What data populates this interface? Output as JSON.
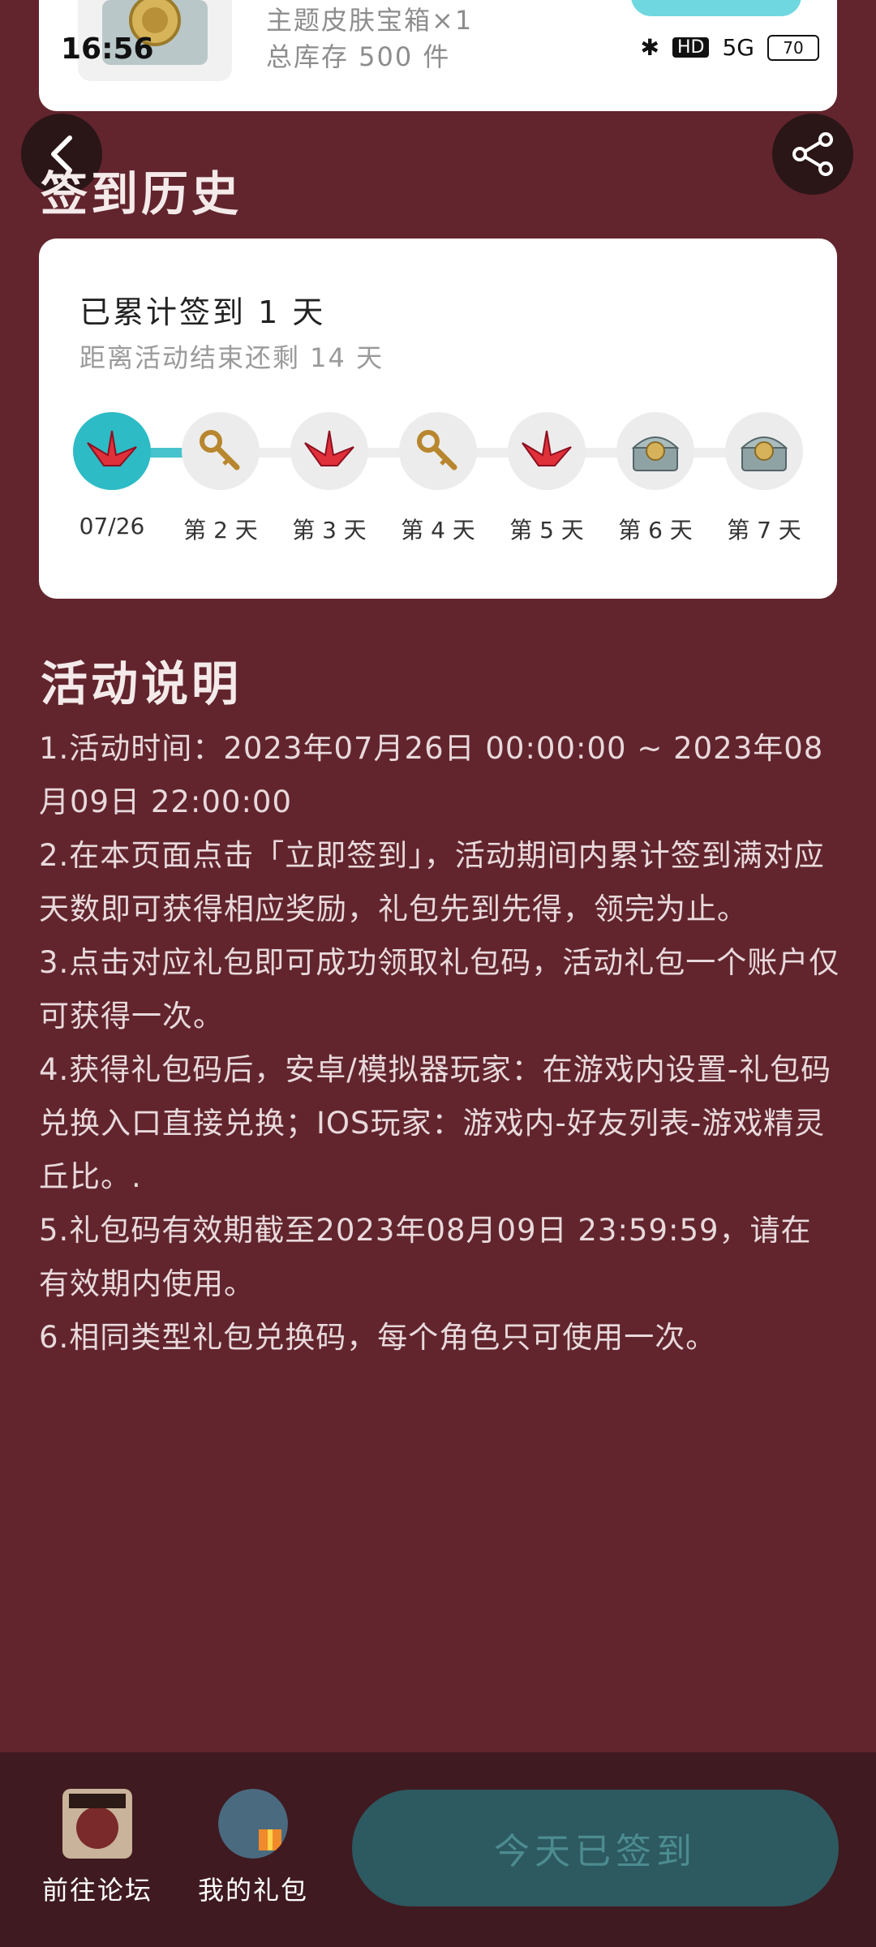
{
  "status": {
    "time": "16:56",
    "battery": "70",
    "hd": "HD",
    "net": "5G"
  },
  "top_card": {
    "line1": "主题皮肤宝箱×1",
    "line2": "总库存 500 件"
  },
  "history": {
    "title": "签到历史",
    "total": "已累计签到 1 天",
    "remain": "距离活动结束还剩 14 天",
    "days": [
      {
        "label": "07/26",
        "icon": "paper-crane-icon"
      },
      {
        "label": "第 2 天",
        "icon": "key-icon"
      },
      {
        "label": "第 3 天",
        "icon": "paper-crane-icon"
      },
      {
        "label": "第 4 天",
        "icon": "key-icon"
      },
      {
        "label": "第 5 天",
        "icon": "paper-crane-icon"
      },
      {
        "label": "第 6 天",
        "icon": "treasure-chest-icon"
      },
      {
        "label": "第 7 天",
        "icon": "treasure-chest-icon"
      }
    ]
  },
  "rules": {
    "title": "活动说明",
    "items": [
      "1.活动时间：2023年07月26日 00:00:00 ~ 2023年08月09日 22:00:00",
      "2.在本页面点击「立即签到」，活动期间内累计签到满对应天数即可获得相应奖励，礼包先到先得，领完为止。",
      "3.点击对应礼包即可成功领取礼包码，活动礼包一个账户仅可获得一次。",
      "4.获得礼包码后，安卓/模拟器玩家：在游戏内设置-礼包码兑换入口直接兑换；IOS玩家：游戏内-好友列表-游戏精灵丘比。.",
      "5.礼包码有效期截至2023年08月09日 23:59:59，请在有效期内使用。",
      "6.相同类型礼包兑换码，每个角色只可使用一次。"
    ]
  },
  "bottom": {
    "forum_label": "前往论坛",
    "gifts_label": "我的礼包",
    "checked_label": "今天已签到"
  },
  "colors": {
    "accent": "#2dbbc6",
    "background": "#62252d",
    "bottom_bar": "#3f1a20"
  }
}
